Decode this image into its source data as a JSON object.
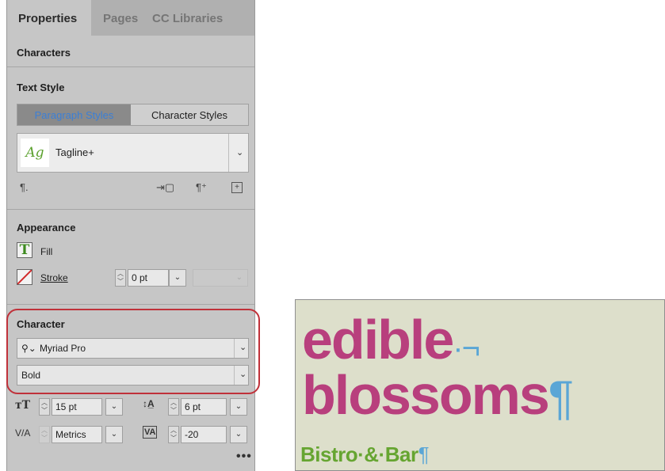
{
  "tabs": [
    {
      "label": "Properties"
    },
    {
      "label": "Pages"
    },
    {
      "label": "CC Libraries"
    }
  ],
  "section_header": "Characters",
  "text_style": {
    "title": "Text Style",
    "segment_left": "Paragraph Styles",
    "segment_right": "Character Styles",
    "style_sample": "Ag",
    "style_name": "Tagline+",
    "icons": [
      "pilcrow-clear-icon",
      "create-style-icon",
      "pilcrow-override-icon",
      "add-style-icon"
    ]
  },
  "appearance": {
    "title": "Appearance",
    "fill_label": "Fill",
    "stroke_label": "Stroke",
    "stroke_weight": "0 pt"
  },
  "character": {
    "title": "Character",
    "font_family": "Myriad Pro",
    "font_style": "Bold",
    "font_size": "15 pt",
    "leading": "6 pt",
    "kerning": "Metrics",
    "tracking": "-20",
    "more_label": "•••"
  },
  "preview": {
    "line1": "edible",
    "line1_mark": "·¬",
    "line2": "blossoms",
    "line2_mark": "¶",
    "line3": "Bistro·&·Bar",
    "line3_mark": "¶"
  },
  "colors": {
    "highlight": "#c0313a",
    "accent_blue": "#3b7fd6",
    "preview_pink": "#b83f7d",
    "preview_green": "#66a531",
    "preview_bg": "#dddfcb"
  }
}
